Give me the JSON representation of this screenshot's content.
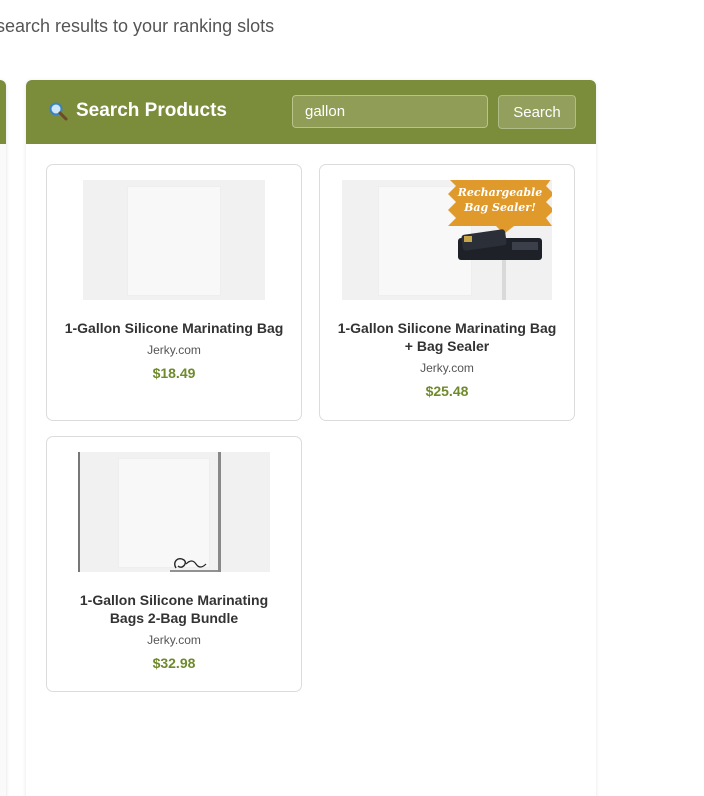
{
  "subtitle": "search results to your ranking slots",
  "search_panel": {
    "title": "Search Products",
    "search_value": "gallon",
    "search_button_label": "Search",
    "header_color": "#7b8c3a"
  },
  "results": [
    {
      "title": "1-Gallon Silicone Marinating Bag",
      "vendor": "Jerky.com",
      "price": "$18.49",
      "image_badge": ""
    },
    {
      "title": "1-Gallon Silicone Marinating Bag + Bag Sealer",
      "vendor": "Jerky.com",
      "price": "$25.48",
      "image_badge": "Rechargeable Bag Sealer!"
    },
    {
      "title": "1-Gallon Silicone Marinating Bags 2-Bag Bundle",
      "vendor": "Jerky.com",
      "price": "$32.98",
      "image_badge": ""
    }
  ],
  "colors": {
    "price": "#6f8a2b",
    "badge": "#e09a2c"
  }
}
